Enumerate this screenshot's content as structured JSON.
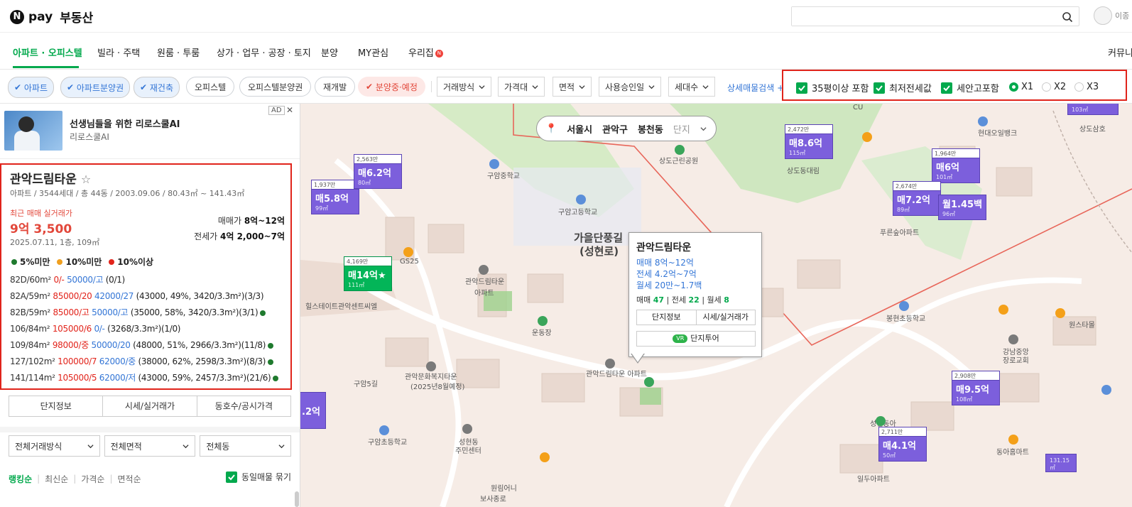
{
  "header": {
    "logo_pay": "pay",
    "logo_title": "부동산",
    "search_placeholder": "",
    "user_name": "이종"
  },
  "nav": {
    "items": [
      "아파트 · 오피스텔",
      "빌라 · 주택",
      "원룸 · 투룸",
      "상가 · 업무 · 공장 · 토지",
      "분양",
      "MY관심",
      "우리집"
    ],
    "right": "커뮤니",
    "badge": "N"
  },
  "filters": {
    "chips": [
      "아파트",
      "아파트분양권",
      "재건축",
      "오피스텔",
      "오피스텔분양권",
      "재개발",
      "분양중·예정"
    ],
    "dropdowns": [
      "거래방식",
      "가격대",
      "면적",
      "사용승인일",
      "세대수"
    ],
    "detail_search": "상세매물검색",
    "options": [
      "35평이상 포함",
      "최저전세값",
      "세안고포함"
    ],
    "radios": [
      "X1",
      "X2",
      "X3"
    ]
  },
  "ad": {
    "title": "선생님들을 위한 리로스쿨AI",
    "sub": "리로스쿨AI",
    "badge": "AD",
    "close": "✕"
  },
  "complex": {
    "name": "관악드림타운",
    "star": "☆",
    "info": "아파트 / 3544세대 / 총 44동 / 2003.09.06 / 80.43㎡ ~ 141.43㎡",
    "recent_label": "최근 매매 실거래가",
    "recent_price": "9억 3,500",
    "recent_date": "2025.07.11, 1층, 109㎡",
    "sale_label": "매매가",
    "sale_range": "8억~12억",
    "jeonse_label": "전세가",
    "jeonse_range": "4억 2,000~7억",
    "legend": [
      "5%미만",
      "10%미만",
      "10%이상"
    ],
    "legend_colors": [
      "#1f7a2e",
      "#f0a020",
      "#e2241b"
    ],
    "rows": [
      {
        "type": "82D/60m²",
        "sale": "0/-",
        "lease": "50000/고",
        "ratio": "(0/1)",
        "dot": false
      },
      {
        "type": "82A/59m²",
        "sale": "85000/20",
        "lease": "42000/27",
        "ratio": "(43000, 49%, 3420/3.3m²)(3/3)",
        "dot": false
      },
      {
        "type": "82B/59m²",
        "sale": "85000/고",
        "lease": "50000/고",
        "ratio": "(35000, 58%, 3420/3.3m²)(3/1)",
        "dot": true
      },
      {
        "type": "106/84m²",
        "sale": "105000/6",
        "lease": "0/-",
        "ratio": "(3268/3.3m²)(1/0)",
        "dot": false
      },
      {
        "type": "109/84m²",
        "sale": "98000/중",
        "lease": "50000/20",
        "ratio": "(48000, 51%, 2966/3.3m²)(11/8)",
        "dot": true
      },
      {
        "type": "127/102m²",
        "sale": "100000/7",
        "lease": "62000/중",
        "ratio": "(38000, 62%, 2598/3.3m²)(8/3)",
        "dot": true
      },
      {
        "type": "141/114m²",
        "sale": "105000/5",
        "lease": "62000/저",
        "ratio": "(43000, 59%, 2457/3.3m²)(21/6)",
        "dot": true
      }
    ],
    "tabs": [
      "단지정보",
      "시세/실거래가",
      "동호수/공시가격"
    ]
  },
  "list_filters": {
    "selects": [
      "전체거래방식",
      "전체면적",
      "전체동"
    ],
    "sorts": [
      "랭킹순",
      "최신순",
      "가격순",
      "면적순"
    ],
    "group_label": "동일매물 묶기"
  },
  "map": {
    "location": [
      "서울시",
      "관악구",
      "봉천동",
      "단지"
    ],
    "markers": [
      {
        "top": "1,937만",
        "main": "매5.8억",
        "sub": "99㎡"
      },
      {
        "top": "2,563만",
        "main": "매6.2억",
        "sub": "80㎡"
      },
      {
        "top": "4,169만",
        "main": "매14억★",
        "sub": "111㎡"
      },
      {
        "top": "2,472만",
        "main": "매8.6억",
        "sub": "115㎡"
      },
      {
        "top": "1,964만",
        "main": "매6억",
        "sub": "101㎡"
      },
      {
        "top": "2,674만",
        "main": "매7.2억",
        "sub": "89㎡"
      },
      {
        "top": "",
        "main": "월1.45백",
        "sub": "96㎡"
      },
      {
        "top": "2,908만",
        "main": "매9.5억",
        "sub": "108㎡"
      },
      {
        "top": "2,711만",
        "main": "매4.1억",
        "sub": "50㎡"
      },
      {
        "top": "",
        "main": "",
        "sub": "131.15㎡"
      },
      {
        "top": "",
        "main": "",
        "sub": "103㎡"
      },
      {
        "top": "",
        "main": ".2억",
        "sub": ""
      }
    ],
    "popup": {
      "title": "관악드림타운",
      "sale": "매매 8억~12억",
      "jeonse": "전세 4.2억~7억",
      "monthly": "월세 20만~1.7백",
      "count_sale_label": "매매",
      "count_sale": "47",
      "count_jeonse_label": "전세",
      "count_jeonse": "22",
      "count_monthly_label": "월세",
      "count_monthly": "8",
      "btn1": "단지정보",
      "btn2": "시세/실거래가",
      "tour": "단지투어",
      "vr": "VR"
    },
    "labels": [
      "구암중학교",
      "구암고등학교",
      "가을단풍길",
      "(성현로)",
      "상도근린공원",
      "GS25",
      "관악드림타운",
      "아파트",
      "힐스테이트관악센트씨엘",
      "운동장",
      "관악문화복지타운",
      "(2025년8월예정)",
      "구암초등학교",
      "성현동",
      "주민센터",
      "원림어니",
      "봉현초등학교",
      "강남중앙",
      "장로교회",
      "원스타몰",
      "성현동아",
      "동아홈마트",
      "일두아파트",
      "푸른숲아파트",
      "CU",
      "현대오일뱅크",
      "상도삼호",
      "상도동대림",
      "구암5길",
      "관악드림타운 아파트",
      "보사종로"
    ]
  }
}
